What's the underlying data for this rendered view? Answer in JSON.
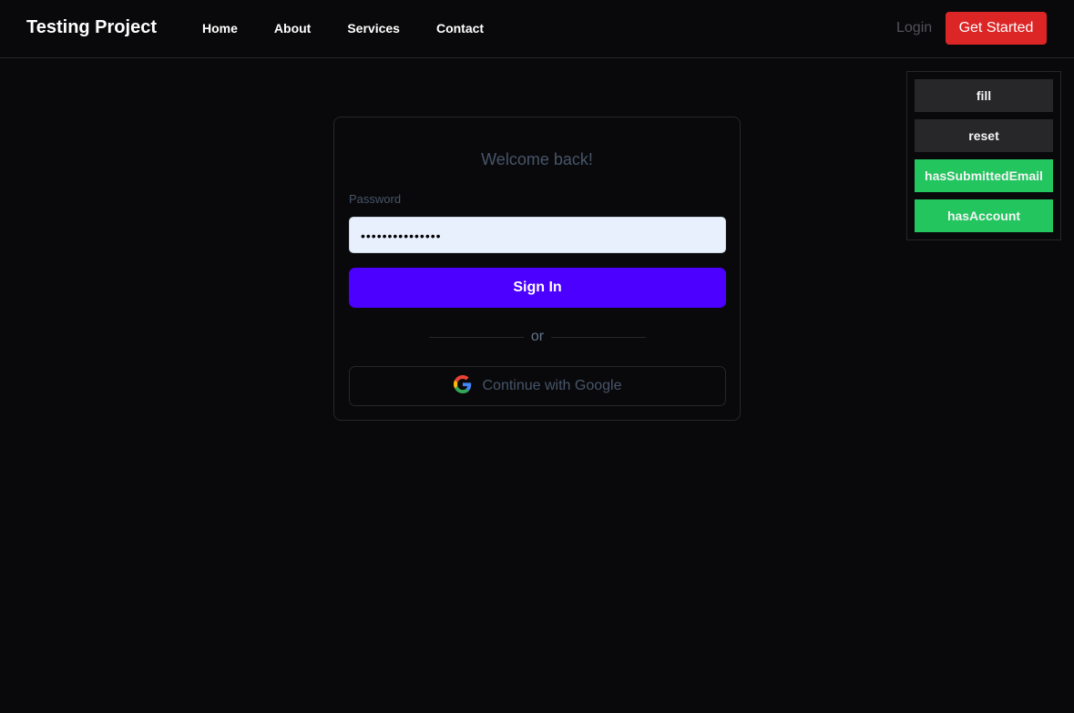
{
  "nav": {
    "brand": "Testing Project",
    "links": [
      "Home",
      "About",
      "Services",
      "Contact"
    ],
    "login": "Login",
    "get_started": "Get Started"
  },
  "debug": {
    "buttons": [
      "fill",
      "reset",
      "hasSubmittedEmail",
      "hasAccount"
    ]
  },
  "card": {
    "title": "Welcome back!",
    "password_label": "Password",
    "password_value": "•••••••••••••••",
    "sign_in": "Sign In",
    "or": "or",
    "google": "Continue with Google"
  },
  "colors": {
    "accent": "#4c00ff",
    "cta": "#dc2626",
    "flag": "#22c55e"
  }
}
